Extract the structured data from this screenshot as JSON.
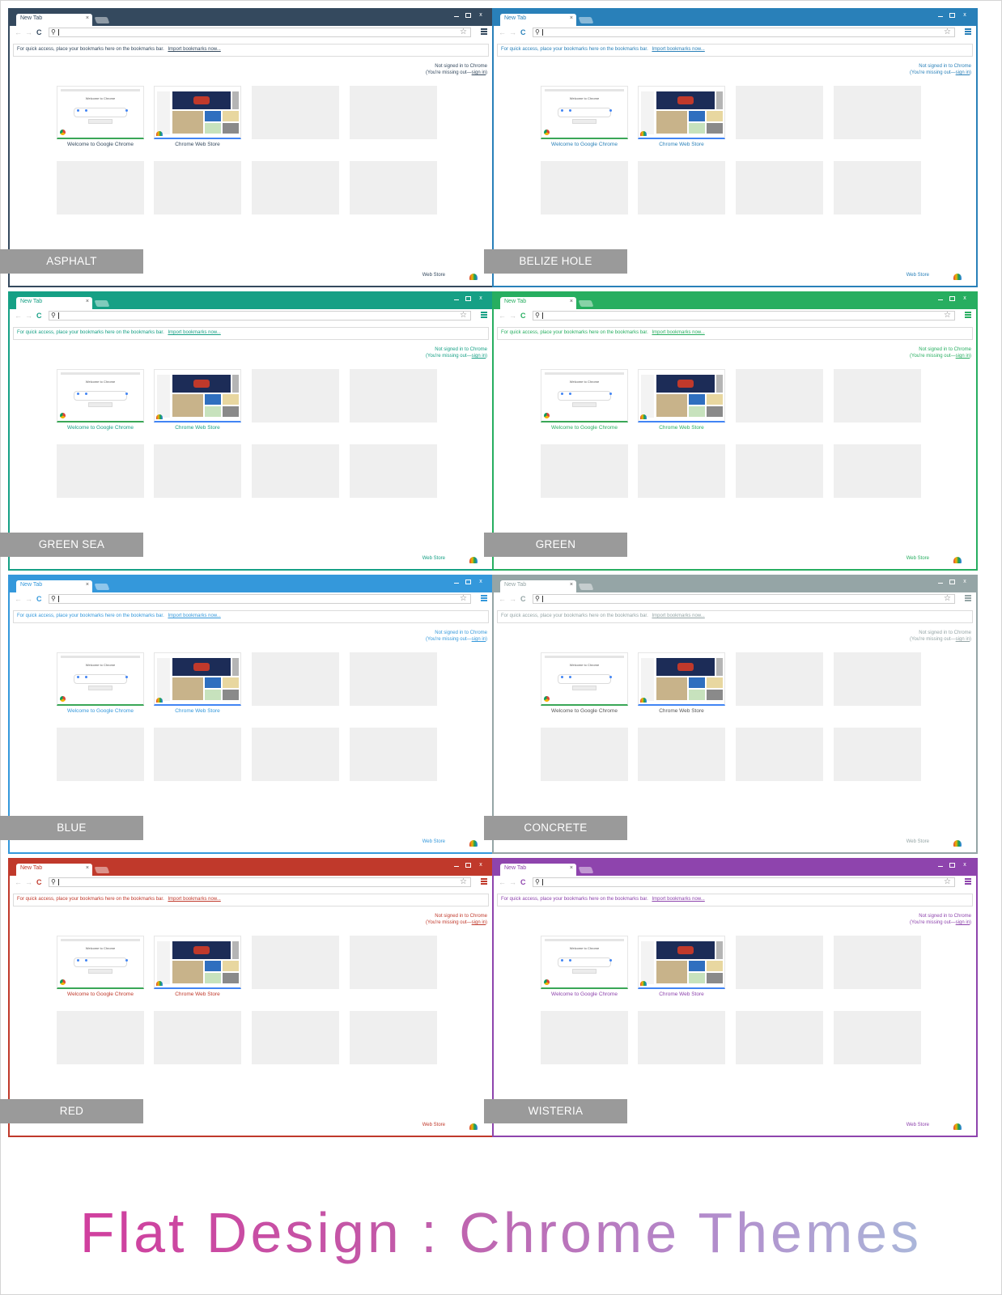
{
  "page_title": "Flat Design : Chrome Themes",
  "browser": {
    "tab_label": "New Tab",
    "tab_close": "×",
    "window_close": "x",
    "nav_back": "←",
    "nav_forward": "→",
    "nav_reload": "C",
    "bookmarks_text": "For quick access, place your bookmarks here on the bookmarks bar.",
    "bookmarks_link": "Import bookmarks now...",
    "signin_line1": "Not signed in to Chrome",
    "signin_line2_prefix": "(You're missing out—",
    "signin_link": "sign in",
    "signin_line2_suffix": ")",
    "tile1_label": "Welcome to Google Chrome",
    "tile2_label": "Chrome Web Store",
    "tile1_thumb_title": "Welcome to Chrome",
    "webstore_label": "Web Store"
  },
  "themes": [
    {
      "name": "ASPHALT",
      "color": "#34495e",
      "label_color": "#34495e"
    },
    {
      "name": "BELIZE HOLE",
      "color": "#2980b9",
      "label_color": "#2980b9"
    },
    {
      "name": "GREEN SEA",
      "color": "#16a085",
      "label_color": "#16a085"
    },
    {
      "name": "GREEN",
      "color": "#27ae60",
      "label_color": "#27ae60"
    },
    {
      "name": "BLUE",
      "color": "#3498db",
      "label_color": "#3498db"
    },
    {
      "name": "CONCRETE",
      "color": "#95a5a6",
      "label_color": "#555555"
    },
    {
      "name": "RED",
      "color": "#c0392b",
      "label_color": "#c0392b"
    },
    {
      "name": "WISTERIA",
      "color": "#8e44ad",
      "label_color": "#8e44ad"
    }
  ]
}
